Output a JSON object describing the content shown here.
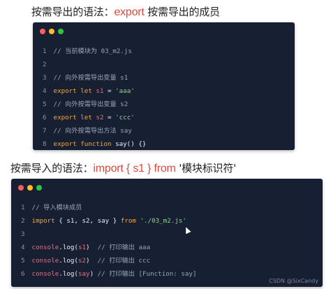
{
  "heading1": {
    "prefix": "按需导出的语法：",
    "keyword": "export",
    "suffix": " 按需导出的成员"
  },
  "heading2": {
    "prefix": "按需导入的语法：",
    "keyword_import": "import",
    "brace_open": " { ",
    "member": "s1",
    "brace_close": " } ",
    "keyword_from": "from",
    "module": " '模块标识符'"
  },
  "colors": {
    "panel_bg": "#172033",
    "dot_red": "#ff5f57",
    "dot_yellow": "#febc2e",
    "dot_green": "#28c840",
    "keyword": "#e0483b"
  },
  "code1": [
    {
      "n": "1",
      "comment": "// 当前模块为 03_m2.js"
    },
    {
      "n": "2"
    },
    {
      "n": "3",
      "comment": "// 向外按需导出变量 s1"
    },
    {
      "n": "4",
      "kw": "export let",
      "var": "s1",
      "eq": " = ",
      "str": "'aaa'"
    },
    {
      "n": "5",
      "comment": "// 向外按需导出变量 s2"
    },
    {
      "n": "6",
      "kw": "export let",
      "var": "s2",
      "eq": " = ",
      "str": "'ccc'"
    },
    {
      "n": "7",
      "comment": "// 向外按需导出方法 say"
    },
    {
      "n": "8",
      "kw": "export function",
      "fn": " say() {}"
    }
  ],
  "code2": [
    {
      "n": "1",
      "comment": "// 导入模块成员"
    },
    {
      "n": "2",
      "kw": "import",
      "body": " { s1, s2, say } ",
      "kw2": "from",
      "str": " './03_m2.js'"
    },
    {
      "n": "3"
    },
    {
      "n": "4",
      "obj": "console",
      "call": ".log(",
      "arg": "s1",
      "close": ")",
      "comment": "  // 打印输出 aaa"
    },
    {
      "n": "5",
      "obj": "console",
      "call": ".log(",
      "arg": "s2",
      "close": ")",
      "comment": "  // 打印输出 ccc"
    },
    {
      "n": "6",
      "obj": "console",
      "call": ".log(",
      "arg": "say",
      "close": ")",
      "comment": " // 打印输出 [Function: say]"
    }
  ],
  "watermark": "CSDN @SixCandy"
}
